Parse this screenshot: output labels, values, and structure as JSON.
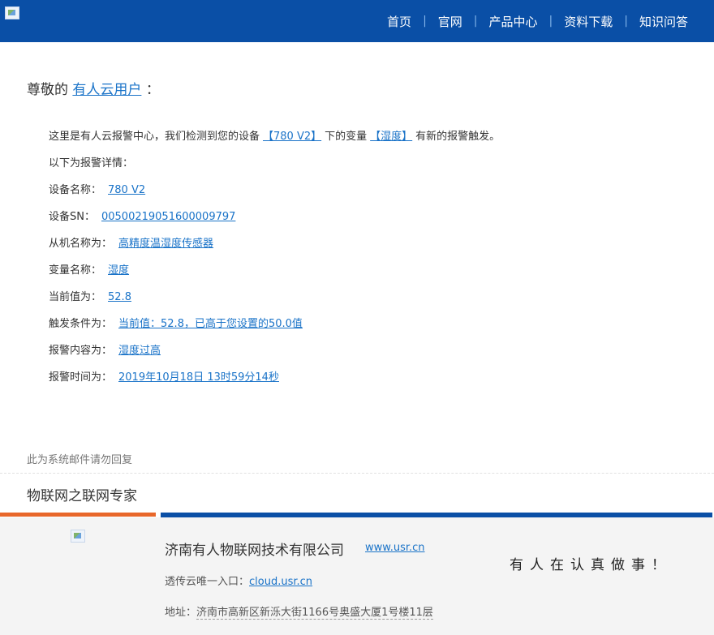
{
  "header": {
    "nav": [
      "首页",
      "官网",
      "产品中心",
      "资料下载",
      "知识问答"
    ]
  },
  "greeting": {
    "prefix": "尊敬的",
    "user": "有人云用户",
    "suffix": "："
  },
  "intro": {
    "text1": "这里是有人云报警中心，我们检测到您的设备",
    "device": "【780 V2】",
    "text2": "下的变量",
    "variable": "【湿度】",
    "text3": "有新的报警触发。"
  },
  "details_heading": "以下为报警详情：",
  "details": [
    {
      "label": "设备名称：",
      "value": "780 V2"
    },
    {
      "label": "设备SN：",
      "value": "00500219051600009797"
    },
    {
      "label": "从机名称为：",
      "value": "高精度温湿度传感器"
    },
    {
      "label": "变量名称：",
      "value": "湿度"
    },
    {
      "label": "当前值为：",
      "value": "52.8"
    },
    {
      "label": "触发条件为：",
      "value": "当前值：52.8，已高于您设置的50.0值"
    },
    {
      "label": "报警内容为：",
      "value": "湿度过高"
    },
    {
      "label": "报警时间为：",
      "value": "2019年10月18日 13时59分14秒"
    }
  ],
  "footer_note": "此为系统邮件请勿回复",
  "tagline": "物联网之联网专家",
  "footer": {
    "company": "济南有人物联网技术有限公司",
    "website": "www.usr.cn",
    "entry_label": "透传云唯一入口：",
    "entry_link": "cloud.usr.cn",
    "address_label": "地址：",
    "address": "济南市高新区新泺大街1166号奥盛大厦1号楼11层",
    "slogan": "有人在认真做事！"
  },
  "colors": {
    "header_bg": "#0a4fa6",
    "link": "#1a73c8",
    "accent_orange": "#e8672a",
    "footer_bg": "#f4f4f4"
  }
}
